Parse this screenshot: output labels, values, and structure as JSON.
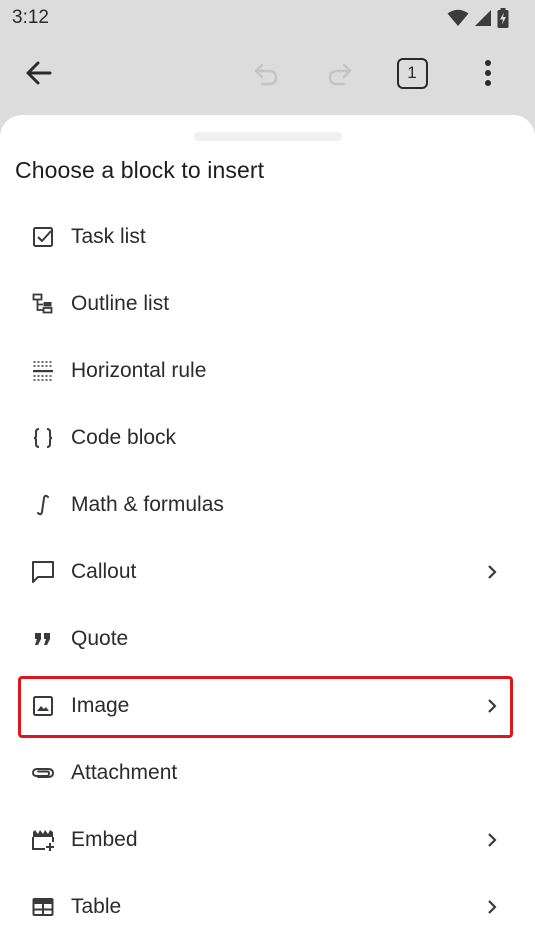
{
  "status_bar": {
    "time": "3:12",
    "icons": [
      "wifi-icon",
      "signal-icon",
      "battery-charging-icon"
    ]
  },
  "toolbar": {
    "back_icon": "arrow-left-icon",
    "undo_icon": "undo-icon",
    "redo_icon": "redo-icon",
    "tab_count": "1",
    "more_icon": "more-vertical-icon"
  },
  "sheet": {
    "title": "Choose a block to insert",
    "items": [
      {
        "label": "Task list",
        "icon": "checkbox-icon",
        "has_submenu": false
      },
      {
        "label": "Outline list",
        "icon": "outline-list-icon",
        "has_submenu": false
      },
      {
        "label": "Horizontal rule",
        "icon": "horizontal-rule-icon",
        "has_submenu": false
      },
      {
        "label": "Code block",
        "icon": "braces-icon",
        "has_submenu": false
      },
      {
        "label": "Math & formulas",
        "icon": "integral-icon",
        "has_submenu": false
      },
      {
        "label": "Callout",
        "icon": "speech-bubble-icon",
        "has_submenu": true
      },
      {
        "label": "Quote",
        "icon": "quote-icon",
        "has_submenu": false
      },
      {
        "label": "Image",
        "icon": "image-icon",
        "has_submenu": true,
        "highlighted": true
      },
      {
        "label": "Attachment",
        "icon": "paperclip-icon",
        "has_submenu": false
      },
      {
        "label": "Embed",
        "icon": "embed-icon",
        "has_submenu": true
      },
      {
        "label": "Table",
        "icon": "table-icon",
        "has_submenu": true
      }
    ]
  },
  "colors": {
    "background_dim": "#dcdcdc",
    "sheet": "#ffffff",
    "highlight": "#e0161d",
    "text": "#2b2b2b",
    "icon": "#3a3a3a",
    "disabled_icon": "#c4c4c4"
  }
}
